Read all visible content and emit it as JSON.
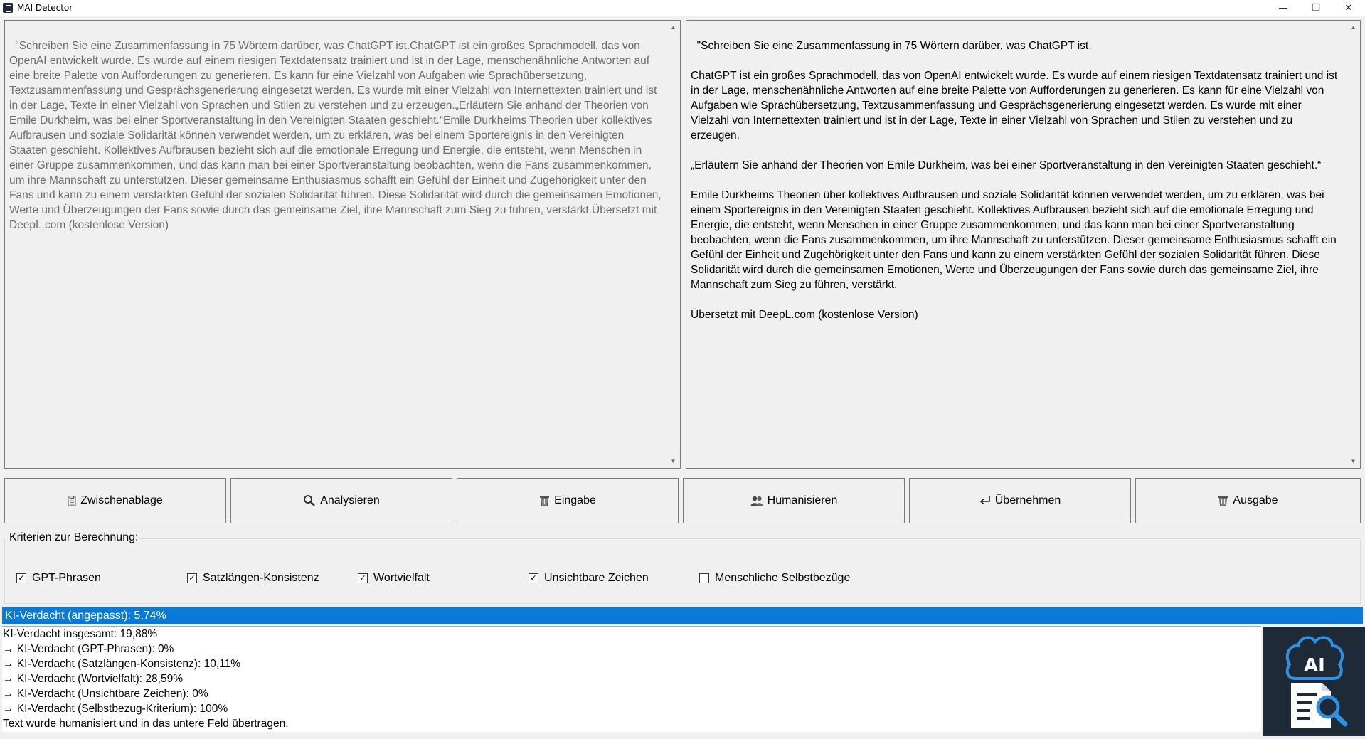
{
  "window": {
    "title": "MAI Detector",
    "minimize": "—",
    "maximize": "❐",
    "close": "✕"
  },
  "input_text": "“Schreiben Sie eine Zusammenfassung in 75 Wörtern darüber, was ChatGPT ist.ChatGPT ist ein großes Sprachmodell, das von OpenAI entwickelt wurde. Es wurde auf einem riesigen Textdatensatz trainiert und ist in der Lage, menschenähnliche Antworten auf eine breite Palette von Aufforderungen zu generieren. Es kann für eine Vielzahl von Aufgaben wie Sprachübersetzung, Textzusammenfassung und Gesprächsgenerierung eingesetzt werden. Es wurde mit einer Vielzahl von Internettexten trainiert und ist in der Lage, Texte in einer Vielzahl von Sprachen und Stilen zu verstehen und zu erzeugen.„Erläutern Sie anhand der Theorien von Emile Durkheim, was bei einer Sportveranstaltung in den Vereinigten Staaten geschieht.“Emile Durkheims Theorien über kollektives Aufbrausen und soziale Solidarität können verwendet werden, um zu erklären, was bei einem Sportereignis in den Vereinigten Staaten geschieht. Kollektives Aufbrausen bezieht sich auf die emotionale Erregung und Energie, die entsteht, wenn Menschen in einer Gruppe zusammenkommen, und das kann man bei einer Sportveranstaltung beobachten, wenn die Fans zusammenkommen, um ihre Mannschaft zu unterstützen. Dieser gemeinsame Enthusiasmus schafft ein Gefühl der Einheit und Zugehörigkeit unter den Fans und kann zu einem verstärkten Gefühl der sozialen Solidarität führen. Diese Solidarität wird durch die gemeinsamen Emotionen, Werte und Überzeugungen der Fans sowie durch das gemeinsame Ziel, ihre Mannschaft zum Sieg zu führen, verstärkt.Übersetzt mit DeepL.com (kostenlose Version)",
  "output_text": "\"Schreiben Sie eine Zusammenfassung in 75 Wörtern darüber, was ChatGPT ist.\n\nChatGPT ist ein großes Sprachmodell, das von OpenAI entwickelt wurde. Es wurde auf einem riesigen Textdatensatz trainiert und ist in der Lage, menschenähnliche Antworten auf eine breite Palette von Aufforderungen zu generieren. Es kann für eine Vielzahl von Aufgaben wie Sprachübersetzung, Textzusammenfassung und Gesprächsgenerierung eingesetzt werden. Es wurde mit einer Vielzahl von Internettexten trainiert und ist in der Lage, Texte in einer Vielzahl von Sprachen und Stilen zu verstehen und zu erzeugen.\n\n„Erläutern Sie anhand der Theorien von Emile Durkheim, was bei einer Sportveranstaltung in den Vereinigten Staaten geschieht.“\n\nEmile Durkheims Theorien über kollektives Aufbrausen und soziale Solidarität können verwendet werden, um zu erklären, was bei einem Sportereignis in den Vereinigten Staaten geschieht. Kollektives Aufbrausen bezieht sich auf die emotionale Erregung und Energie, die entsteht, wenn Menschen in einer Gruppe zusammenkommen, und das kann man bei einer Sportveranstaltung beobachten, wenn die Fans zusammenkommen, um ihre Mannschaft zu unterstützen. Dieser gemeinsame Enthusiasmus schafft ein Gefühl der Einheit und Zugehörigkeit unter den Fans und kann zu einem verstärkten Gefühl der sozialen Solidarität führen. Diese Solidarität wird durch die gemeinsamen Emotionen, Werte und Überzeugungen der Fans sowie durch das gemeinsame Ziel, ihre Mannschaft zum Sieg zu führen, verstärkt.\n\nÜbersetzt mit DeepL.com (kostenlose Version)",
  "buttons": [
    {
      "label": "Zwischenablage",
      "icon": "clipboard-icon"
    },
    {
      "label": "Analysieren",
      "icon": "magnifier-icon"
    },
    {
      "label": "Eingabe",
      "icon": "trash-icon"
    },
    {
      "label": "Humanisieren",
      "icon": "people-icon"
    },
    {
      "label": "Übernehmen",
      "icon": "return-arrow-icon"
    },
    {
      "label": "Ausgabe",
      "icon": "trash-icon"
    }
  ],
  "criteria": {
    "label": "Kriterien zur Berechnung:",
    "options": [
      {
        "label": "GPT-Phrasen",
        "checked": true
      },
      {
        "label": "Satzlängen-Konsistenz",
        "checked": true
      },
      {
        "label": "Wortvielfalt",
        "checked": true
      },
      {
        "label": "Unsichtbare Zeichen",
        "checked": true
      },
      {
        "label": "Menschliche Selbstbezüge",
        "checked": false
      }
    ]
  },
  "progress": {
    "label": "KI-Verdacht (angepasst): 5,74%",
    "fraction": 1.0,
    "color": "#0a7ad6"
  },
  "log": [
    "KI-Verdacht insgesamt: 19,88%",
    "→ KI-Verdacht (GPT-Phrasen): 0%",
    "→ KI-Verdacht (Satzlängen-Konsistenz): 10,11%",
    "→ KI-Verdacht (Wortvielfalt): 28,59%",
    "→ KI-Verdacht (Unsichtbare Zeichen): 0%",
    "→ KI-Verdacht (Selbstbezug-Kriterium): 100%",
    "Text wurde humanisiert und in das untere Feld übertragen."
  ],
  "logo": {
    "text": "AI",
    "icon": "ai-document-search-logo",
    "bg_color": "#1e2a38",
    "accent_color": "#2f8fe0"
  }
}
